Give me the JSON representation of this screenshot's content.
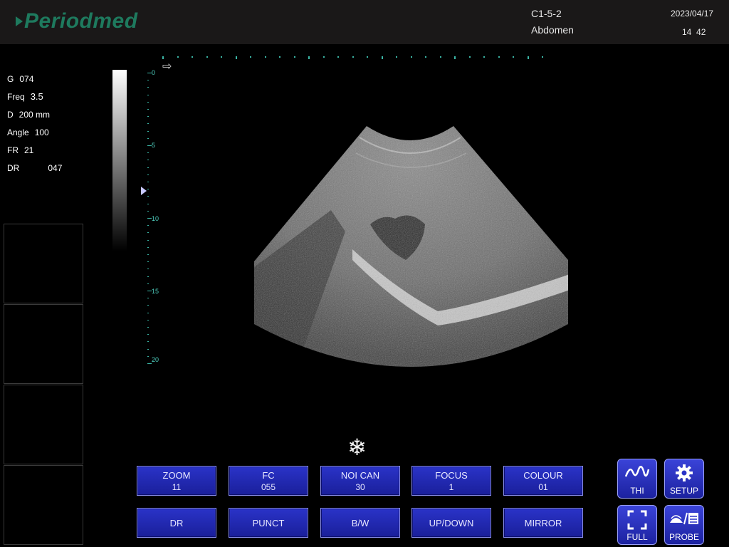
{
  "header": {
    "logo": "Periodmed",
    "probe": "C1-5-2",
    "preset": "Abdomen",
    "date": "2023/04/17",
    "time": "14  42"
  },
  "params": [
    {
      "key": "G",
      "value": "074"
    },
    {
      "key": "Freq",
      "value": "3.5"
    },
    {
      "key": "D",
      "value": "200 mm"
    },
    {
      "key": "Angle",
      "value": "100"
    },
    {
      "key": "FR",
      "value": "21"
    },
    {
      "key": "DR",
      "value": "047"
    }
  ],
  "depth_ruler": {
    "labels": [
      "0",
      "5",
      "10",
      "15",
      "20"
    ],
    "unit": "cm"
  },
  "freeze_icon": "snowflake-icon",
  "buttons_row1": [
    {
      "label": "ZOOM",
      "value": "11"
    },
    {
      "label": "FC",
      "value": "055"
    },
    {
      "label": "NOI CAN",
      "value": "30"
    },
    {
      "label": "FOCUS",
      "value": "1"
    },
    {
      "label": "COLOUR",
      "value": "01"
    }
  ],
  "buttons_row2": [
    {
      "label": "DR"
    },
    {
      "label": "PUNCT"
    },
    {
      "label": "B/W"
    },
    {
      "label": "UP/DOWN"
    },
    {
      "label": "MIRROR"
    }
  ],
  "icon_buttons": [
    {
      "label": "THI",
      "icon": "wave-icon"
    },
    {
      "label": "SETUP",
      "icon": "gear-icon"
    },
    {
      "label": "FULL",
      "icon": "fullscreen-icon"
    },
    {
      "label": "PROBE",
      "icon": "probe-icon"
    }
  ],
  "colors": {
    "header_bg": "#1a1818",
    "logo": "#1e7a5e",
    "button": "#2a33c8",
    "ruler": "#3ab5a5"
  }
}
